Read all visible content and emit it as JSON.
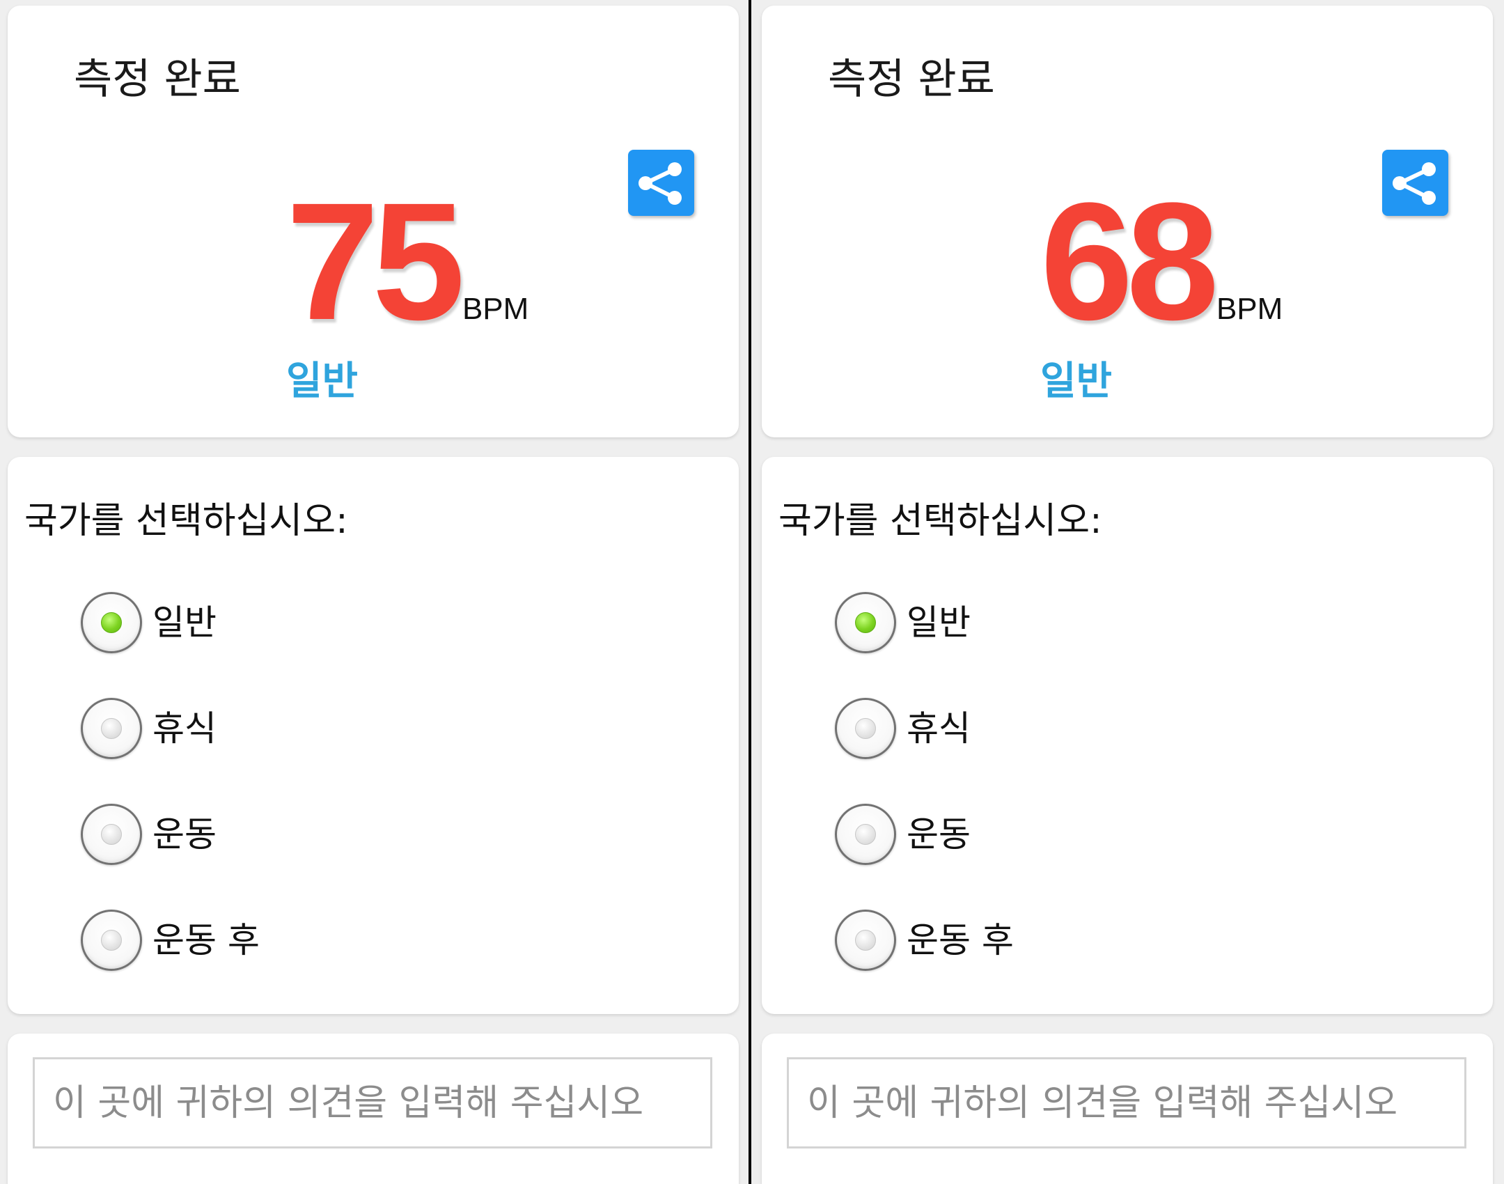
{
  "colors": {
    "bpm_value": "#f44336",
    "status": "#2fa4dd",
    "share_button": "#2196f3",
    "radio_selected": "#7dd321"
  },
  "panels": [
    {
      "title": "측정 완료",
      "share_icon": "share-icon",
      "bpm_value": "75",
      "bpm_unit": "BPM",
      "status": "일반",
      "question": "국가를 선택하십시오:",
      "options": [
        {
          "label": "일반",
          "selected": true
        },
        {
          "label": "휴식",
          "selected": false
        },
        {
          "label": "운동",
          "selected": false
        },
        {
          "label": "운동 후",
          "selected": false
        }
      ],
      "comment_placeholder": "이 곳에 귀하의 의견을 입력해 주십시오"
    },
    {
      "title": "측정 완료",
      "share_icon": "share-icon",
      "bpm_value": "68",
      "bpm_unit": "BPM",
      "status": "일반",
      "question": "국가를 선택하십시오:",
      "options": [
        {
          "label": "일반",
          "selected": true
        },
        {
          "label": "휴식",
          "selected": false
        },
        {
          "label": "운동",
          "selected": false
        },
        {
          "label": "운동 후",
          "selected": false
        }
      ],
      "comment_placeholder": "이 곳에 귀하의 의견을 입력해 주십시오"
    }
  ]
}
